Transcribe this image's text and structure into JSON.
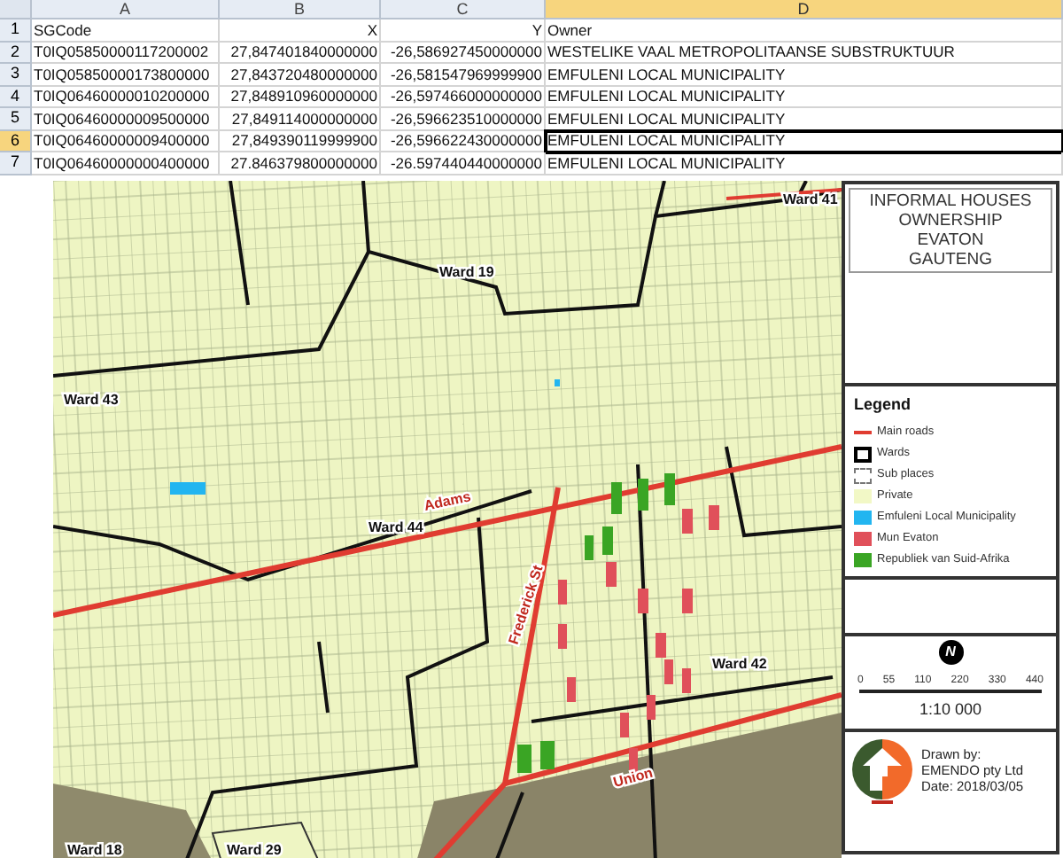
{
  "spreadsheet": {
    "columns": [
      {
        "label": "A",
        "selected": false
      },
      {
        "label": "B",
        "selected": false
      },
      {
        "label": "C",
        "selected": false
      },
      {
        "label": "D",
        "selected": true
      }
    ],
    "rows": [
      {
        "number": "1",
        "selected": false,
        "cells": [
          "SGCode",
          "X",
          "Y",
          "Owner"
        ]
      },
      {
        "number": "2",
        "selected": false,
        "cells": [
          "T0IQ05850000117200002",
          "27,847401840000000",
          "-26,586927450000000",
          "WESTELIKE VAAL METROPOLITAANSE SUBSTRUKTUUR"
        ]
      },
      {
        "number": "3",
        "selected": false,
        "cells": [
          "T0IQ05850000173800000",
          "27,843720480000000",
          "-26,581547969999900",
          "EMFULENI LOCAL MUNICIPALITY"
        ]
      },
      {
        "number": "4",
        "selected": false,
        "cells": [
          "T0IQ06460000010200000",
          "27,848910960000000",
          "-26,597466000000000",
          "EMFULENI LOCAL MUNICIPALITY"
        ]
      },
      {
        "number": "5",
        "selected": false,
        "cells": [
          "T0IQ06460000009500000",
          "27,849114000000000",
          "-26,596623510000000",
          "EMFULENI LOCAL MUNICIPALITY"
        ]
      },
      {
        "number": "6",
        "selected": true,
        "cells": [
          "T0IQ06460000009400000",
          "27,849390119999900",
          "-26,596622430000000",
          "EMFULENI LOCAL MUNICIPALITY"
        ]
      },
      {
        "number": "7",
        "selected": false,
        "cells": [
          "T0IQ06460000000400000",
          "27.846379800000000",
          "-26.597440440000000",
          "EMFULENI LOCAL MUNICIPALITY"
        ]
      }
    ]
  },
  "map": {
    "ward_labels": [
      "Ward 41",
      "Ward 19",
      "Ward 43",
      "Ward 44",
      "Ward 42",
      "Ward 29",
      "Ward 18"
    ],
    "road_labels": [
      "Adams",
      "Frederick St",
      "Union"
    ]
  },
  "panel": {
    "title": [
      "INFORMAL HOUSES",
      "OWNERSHIP",
      "EVATON",
      "GAUTENG"
    ],
    "legend": {
      "title": "Legend",
      "items": [
        {
          "kind": "line",
          "label": "Main roads",
          "color": "#e03c31"
        },
        {
          "kind": "wards",
          "label": "Wards"
        },
        {
          "kind": "subplaces",
          "label": "Sub places"
        },
        {
          "kind": "swatch",
          "label": "Private",
          "color": "#f2f8c6"
        },
        {
          "kind": "swatch",
          "label": "Emfuleni Local Municipality",
          "color": "#22b5f0"
        },
        {
          "kind": "swatch",
          "label": "Mun Evaton",
          "color": "#e0505a"
        },
        {
          "kind": "swatch",
          "label": "Republiek van Suid-Afrika",
          "color": "#3aa524"
        }
      ]
    },
    "north": "N",
    "scale_ticks": [
      "0",
      "55",
      "110",
      "220",
      "330",
      "440"
    ],
    "scale": "1:10 000",
    "credits": [
      "Drawn by:",
      "EMENDO pty Ltd",
      "Date: 2018/03/05"
    ]
  }
}
